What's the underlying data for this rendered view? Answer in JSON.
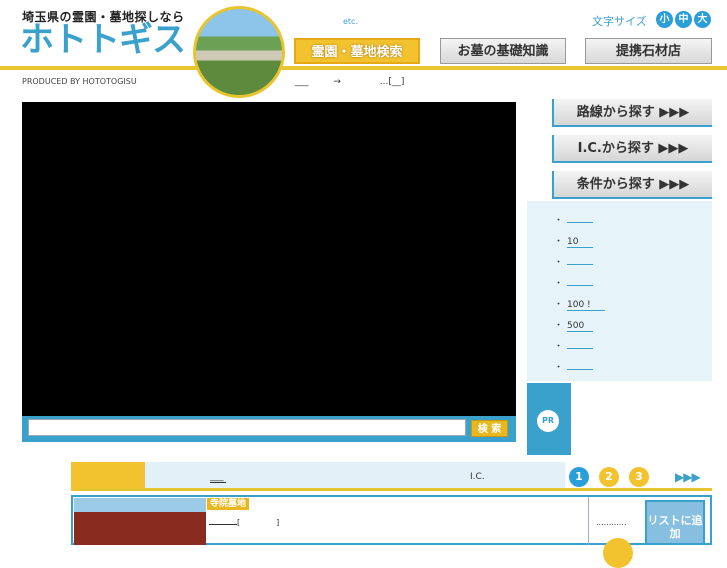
{
  "header": {
    "tagline": "埼玉県の霊園・墓地探しなら",
    "logo": "ホトトギス",
    "produced_by": "PRODUCED BY HOTOTOGISU",
    "etc": "etc.",
    "font_size_label": "文字サイズ",
    "font_sizes": [
      "小",
      "中",
      "大"
    ]
  },
  "nav": {
    "search": "霊園・墓地検索",
    "basics": "お墓の基礎知識",
    "partners": "提携石材店"
  },
  "breadcrumb": [
    "___",
    "→",
    "...[__]"
  ],
  "search": {
    "placeholder": "",
    "button": "検 索"
  },
  "sidebar": {
    "by_route": "路線から探す ▶▶▶",
    "by_ic": "I.C.から探す ▶▶▶",
    "by_condition": "条件から探す ▶▶▶",
    "items": [
      "",
      "10",
      "",
      "",
      "100 !",
      "500",
      "",
      ""
    ],
    "pr": "PR"
  },
  "tabs": {
    "label_1": "___",
    "label_2": "I.C."
  },
  "pagination": {
    "pages": [
      "1",
      "2",
      "3"
    ],
    "next": "▶▶▶"
  },
  "result": {
    "tag": "寺院墓地",
    "name_prefix": "[",
    "name_suffix": "]",
    "dots": "............",
    "add_to_list": "リストに追加"
  },
  "colors": {
    "accent_blue": "#3aa0cc",
    "accent_yellow": "#f2c22f"
  }
}
